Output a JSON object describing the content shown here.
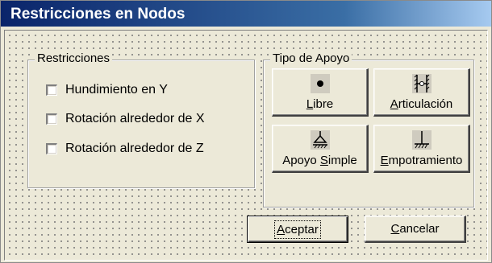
{
  "window": {
    "title": "Restricciones en Nodos"
  },
  "restricciones": {
    "legend": "Restricciones",
    "items": [
      {
        "label": "Hundimiento en Y",
        "checked": false
      },
      {
        "label": "Rotación alrededor de X",
        "checked": false
      },
      {
        "label": "Rotación alrededor de Z",
        "checked": false
      }
    ]
  },
  "tipo_apoyo": {
    "legend": "Tipo de Apoyo",
    "buttons": [
      {
        "accel": "L",
        "rest": "ibre",
        "icon": "free-node-icon"
      },
      {
        "accel": "A",
        "rest": "rticulación",
        "icon": "pin-support-icon"
      },
      {
        "pre": "Apoyo ",
        "accel": "S",
        "rest": "imple",
        "icon": "roller-support-icon"
      },
      {
        "accel": "E",
        "rest": "mpotramiento",
        "icon": "fixed-support-icon"
      }
    ]
  },
  "footer": {
    "ok": {
      "accel": "A",
      "rest": "ceptar"
    },
    "cancel": {
      "accel": "C",
      "rest": "ancelar"
    }
  }
}
